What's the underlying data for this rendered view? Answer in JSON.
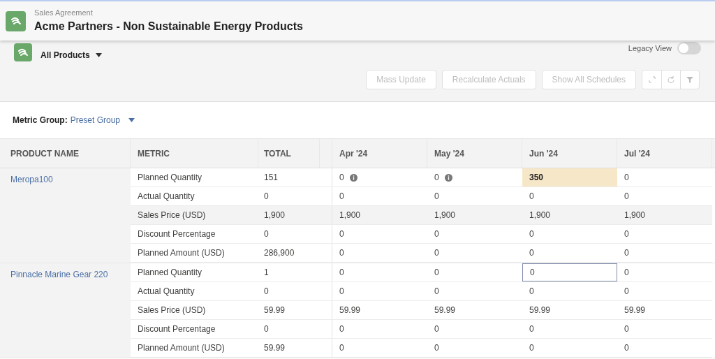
{
  "header": {
    "object_type": "Sales Agreement",
    "title": "Acme Partners - Non Sustainable Energy Products"
  },
  "view": {
    "label": "All Products",
    "legacy_view": {
      "label": "Legacy View",
      "on": false
    }
  },
  "toolbar": {
    "buttons": [
      {
        "label": "Mass Update",
        "disabled": true
      },
      {
        "label": "Recalculate Actuals",
        "disabled": true
      },
      {
        "label": "Show All Schedules",
        "disabled": true
      }
    ]
  },
  "metric_group": {
    "label": "Metric Group:",
    "value": "Preset Group"
  },
  "table": {
    "columns": [
      "PRODUCT NAME",
      "METRIC",
      "TOTAL",
      "Apr '24",
      "May '24",
      "Jun '24",
      "Jul '24"
    ],
    "products": [
      {
        "name": "Meropa100",
        "rows": [
          {
            "metric": "Planned Quantity",
            "total": "151",
            "hovered": false,
            "cells": [
              {
                "value": "0",
                "info": true,
                "edited": false,
                "focused": false
              },
              {
                "value": "0",
                "info": true,
                "edited": false,
                "focused": false
              },
              {
                "value": "350",
                "info": false,
                "edited": true,
                "focused": false
              },
              {
                "value": "0",
                "info": false,
                "edited": false,
                "focused": false
              }
            ]
          },
          {
            "metric": "Actual Quantity",
            "total": "0",
            "hovered": false,
            "cells": [
              {
                "value": "0",
                "info": false,
                "edited": false,
                "focused": false
              },
              {
                "value": "0",
                "info": false,
                "edited": false,
                "focused": false
              },
              {
                "value": "0",
                "info": false,
                "edited": false,
                "focused": false
              },
              {
                "value": "0",
                "info": false,
                "edited": false,
                "focused": false
              }
            ]
          },
          {
            "metric": "Sales Price (USD)",
            "total": "1,900",
            "hovered": true,
            "cells": [
              {
                "value": "1,900",
                "info": false,
                "edited": false,
                "focused": false
              },
              {
                "value": "1,900",
                "info": false,
                "edited": false,
                "focused": false
              },
              {
                "value": "1,900",
                "info": false,
                "edited": false,
                "focused": false
              },
              {
                "value": "1,900",
                "info": false,
                "edited": false,
                "focused": false
              }
            ]
          },
          {
            "metric": "Discount Percentage",
            "total": "0",
            "hovered": false,
            "cells": [
              {
                "value": "0",
                "info": false,
                "edited": false,
                "focused": false
              },
              {
                "value": "0",
                "info": false,
                "edited": false,
                "focused": false
              },
              {
                "value": "0",
                "info": false,
                "edited": false,
                "focused": false
              },
              {
                "value": "0",
                "info": false,
                "edited": false,
                "focused": false
              }
            ]
          },
          {
            "metric": "Planned Amount (USD)",
            "total": "286,900",
            "hovered": false,
            "cells": [
              {
                "value": "0",
                "info": false,
                "edited": false,
                "focused": false
              },
              {
                "value": "0",
                "info": false,
                "edited": false,
                "focused": false
              },
              {
                "value": "0",
                "info": false,
                "edited": false,
                "focused": false
              },
              {
                "value": "0",
                "info": false,
                "edited": false,
                "focused": false
              }
            ]
          }
        ]
      },
      {
        "name": "Pinnacle Marine Gear 220",
        "rows": [
          {
            "metric": "Planned Quantity",
            "total": "1",
            "hovered": false,
            "cells": [
              {
                "value": "0",
                "info": false,
                "edited": false,
                "focused": false
              },
              {
                "value": "0",
                "info": false,
                "edited": false,
                "focused": false
              },
              {
                "value": "0",
                "info": false,
                "edited": false,
                "focused": true
              },
              {
                "value": "0",
                "info": false,
                "edited": false,
                "focused": false
              }
            ]
          },
          {
            "metric": "Actual Quantity",
            "total": "0",
            "hovered": false,
            "cells": [
              {
                "value": "0",
                "info": false,
                "edited": false,
                "focused": false
              },
              {
                "value": "0",
                "info": false,
                "edited": false,
                "focused": false
              },
              {
                "value": "0",
                "info": false,
                "edited": false,
                "focused": false
              },
              {
                "value": "0",
                "info": false,
                "edited": false,
                "focused": false
              }
            ]
          },
          {
            "metric": "Sales Price (USD)",
            "total": "59.99",
            "hovered": false,
            "cells": [
              {
                "value": "59.99",
                "info": false,
                "edited": false,
                "focused": false
              },
              {
                "value": "59.99",
                "info": false,
                "edited": false,
                "focused": false
              },
              {
                "value": "59.99",
                "info": false,
                "edited": false,
                "focused": false
              },
              {
                "value": "59.99",
                "info": false,
                "edited": false,
                "focused": false
              }
            ]
          },
          {
            "metric": "Discount Percentage",
            "total": "0",
            "hovered": false,
            "cells": [
              {
                "value": "0",
                "info": false,
                "edited": false,
                "focused": false
              },
              {
                "value": "0",
                "info": false,
                "edited": false,
                "focused": false
              },
              {
                "value": "0",
                "info": false,
                "edited": false,
                "focused": false
              },
              {
                "value": "0",
                "info": false,
                "edited": false,
                "focused": false
              }
            ]
          },
          {
            "metric": "Planned Amount (USD)",
            "total": "59.99",
            "hovered": false,
            "cells": [
              {
                "value": "0",
                "info": false,
                "edited": false,
                "focused": false
              },
              {
                "value": "0",
                "info": false,
                "edited": false,
                "focused": false
              },
              {
                "value": "0",
                "info": false,
                "edited": false,
                "focused": false
              },
              {
                "value": "0",
                "info": false,
                "edited": false,
                "focused": false
              }
            ]
          }
        ]
      }
    ]
  }
}
